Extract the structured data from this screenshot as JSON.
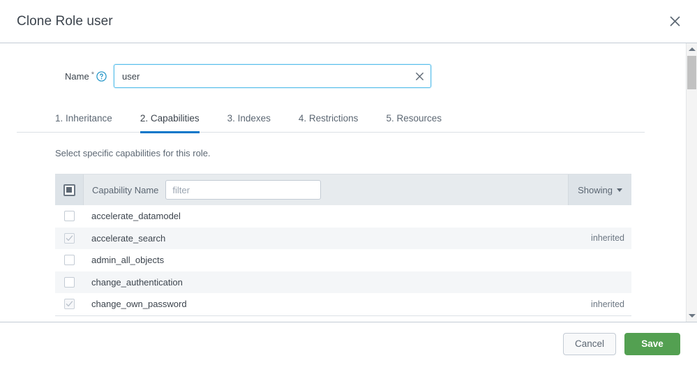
{
  "modal": {
    "title": "Clone Role user",
    "close_icon": "close-icon"
  },
  "form": {
    "name_label": "Name",
    "required_marker": "*",
    "help_icon": "help-circle-icon",
    "name_value": "user",
    "name_placeholder": "",
    "clear_icon": "clear-x-icon"
  },
  "tabs": [
    {
      "label": "1. Inheritance",
      "active": false
    },
    {
      "label": "2. Capabilities",
      "active": true
    },
    {
      "label": "3. Indexes",
      "active": false
    },
    {
      "label": "4. Restrictions",
      "active": false
    },
    {
      "label": "5. Resources",
      "active": false
    }
  ],
  "description": "Select specific capabilities for this role.",
  "table": {
    "select_all_state": "indeterminate",
    "column_name_header": "Capability Name",
    "filter_placeholder": "filter",
    "filter_value": "",
    "showing_label": "Showing",
    "showing_caret_icon": "caret-down-icon",
    "rows": [
      {
        "name": "accelerate_datamodel",
        "checked": false,
        "disabled": false,
        "tag": ""
      },
      {
        "name": "accelerate_search",
        "checked": true,
        "disabled": true,
        "tag": "inherited"
      },
      {
        "name": "admin_all_objects",
        "checked": false,
        "disabled": false,
        "tag": ""
      },
      {
        "name": "change_authentication",
        "checked": false,
        "disabled": false,
        "tag": ""
      },
      {
        "name": "change_own_password",
        "checked": true,
        "disabled": true,
        "tag": "inherited"
      }
    ]
  },
  "scrollbar": {
    "up_arrow_icon": "triangle-up-icon",
    "down_arrow_icon": "triangle-down-icon"
  },
  "footer": {
    "cancel_label": "Cancel",
    "save_label": "Save"
  },
  "colors": {
    "accent_blue": "#0877c9",
    "focus_border": "#5bc0eb",
    "save_green": "#53a051",
    "text_primary": "#3c444d",
    "text_secondary": "#5c6773",
    "header_bg": "#e7ebee",
    "row_alt_bg": "#f4f6f8"
  }
}
